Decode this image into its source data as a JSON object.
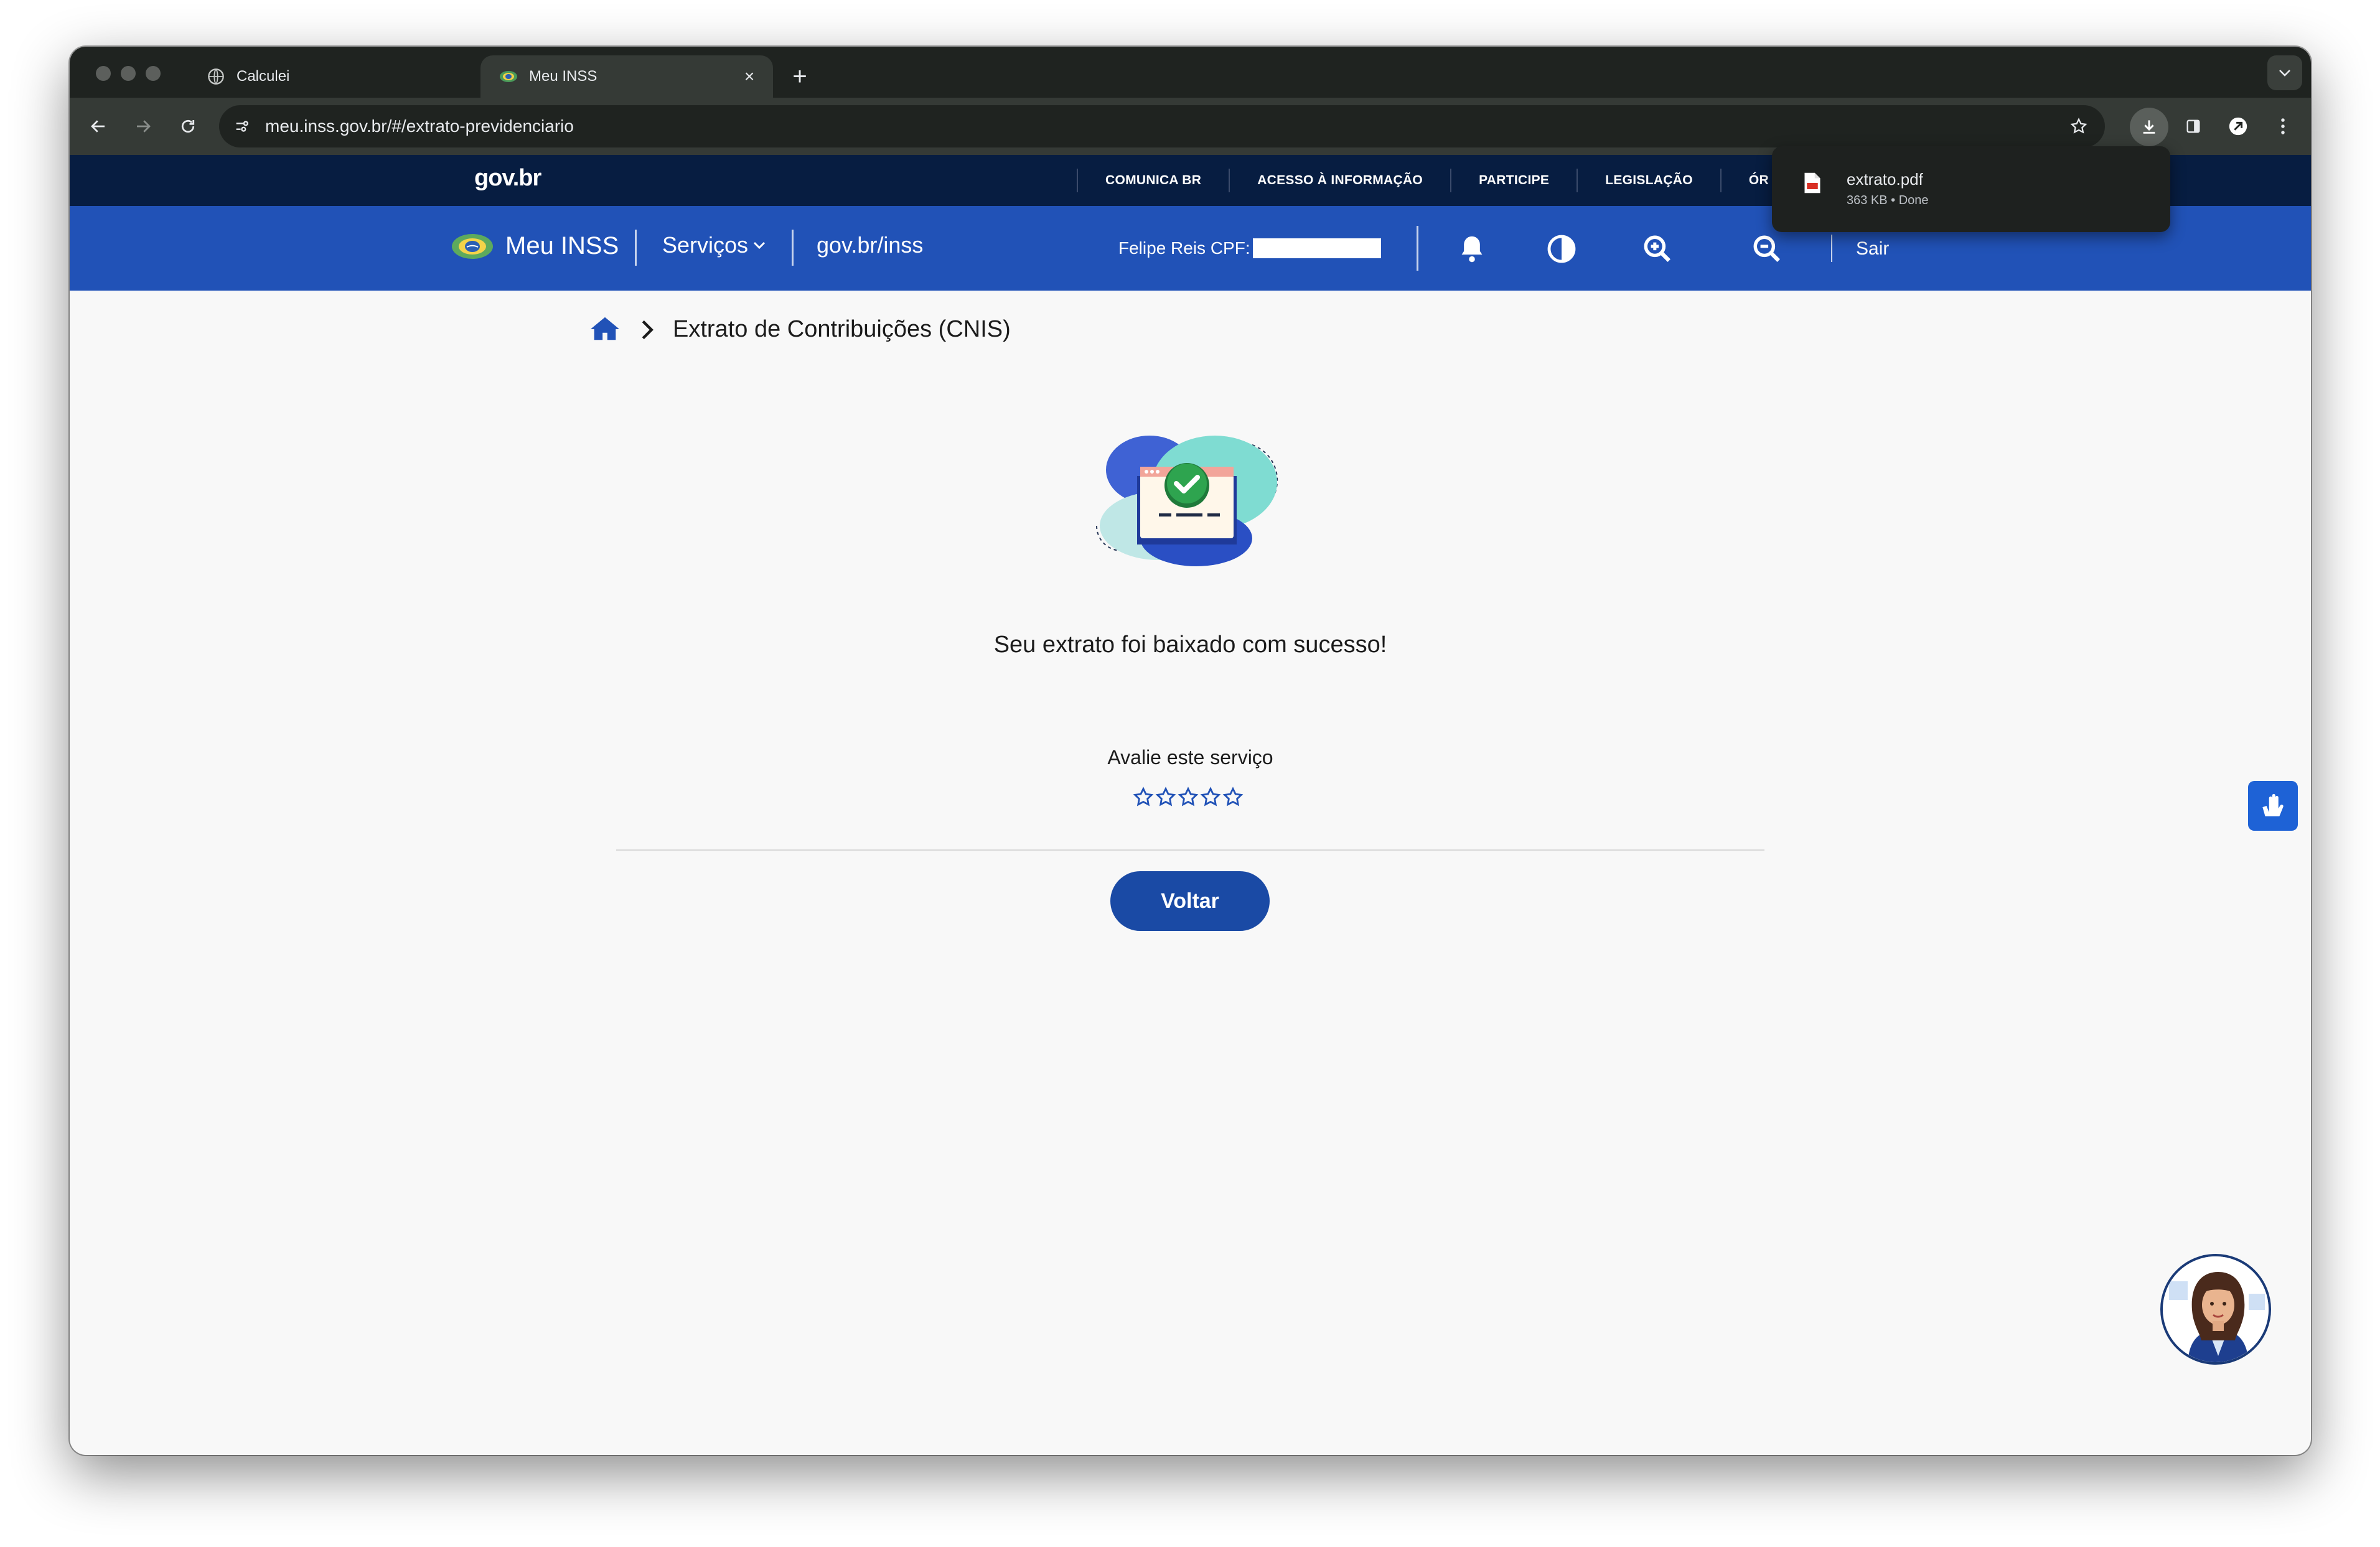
{
  "browser": {
    "tabs": [
      {
        "title": "Calculei",
        "active": false
      },
      {
        "title": "Meu INSS",
        "active": true
      }
    ],
    "url": "meu.inss.gov.br/#/extrato-previdenciario",
    "download": {
      "filename": "extrato.pdf",
      "meta": "363 KB • Done"
    }
  },
  "govbar": {
    "logo": "gov.br",
    "links": [
      "COMUNICA BR",
      "ACESSO À INFORMAÇÃO",
      "PARTICIPE",
      "LEGISLAÇÃO",
      "ÓR"
    ]
  },
  "header": {
    "title": "Meu INSS",
    "servicos": "Serviços",
    "govinss": "gov.br/inss",
    "user_label": "Felipe Reis  CPF:",
    "logout": "Sair"
  },
  "breadcrumb": {
    "current": "Extrato de Contribuições (CNIS)"
  },
  "main": {
    "success_message": "Seu extrato foi baixado com sucesso!",
    "rating_label": "Avalie este serviço",
    "rating": {
      "filled": 0,
      "max": 5
    },
    "back_button": "Voltar"
  },
  "colors": {
    "gov_navy": "#071d41",
    "inss_blue": "#2152b7",
    "button_blue": "#1a4aa5",
    "browser_dark": "#1f2320"
  }
}
